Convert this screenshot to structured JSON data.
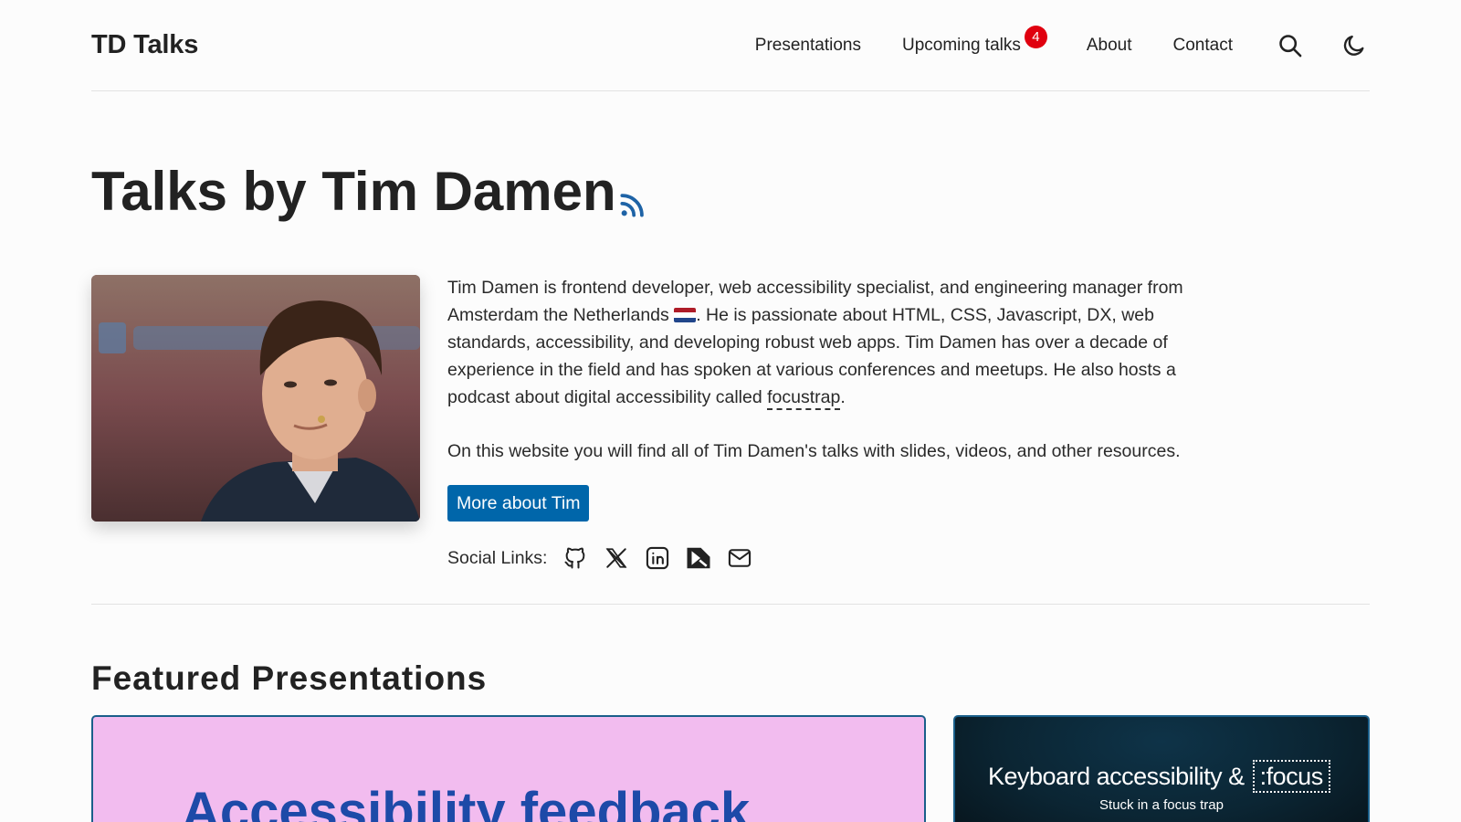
{
  "header": {
    "brand": "TD Talks",
    "nav": [
      {
        "label": "Presentations"
      },
      {
        "label": "Upcoming talks",
        "badge": "4"
      },
      {
        "label": "About"
      },
      {
        "label": "Contact"
      }
    ],
    "icons": [
      "search-icon",
      "moon-icon"
    ]
  },
  "page": {
    "title": "Talks by Tim Damen",
    "title_icon": "rss-icon"
  },
  "hero": {
    "photo_alt": "Photo of Tim Damen",
    "bio_part1": "Tim Damen is frontend developer, web accessibility specialist, and engineering manager from Amsterdam the Netherlands ",
    "bio_part2": ". He is passionate about HTML, CSS, Javascript, DX, web standards, accessibility, and developing robust web apps. Tim Damen has over a decade of experience in the field and has spoken at various conferences and meetups. He also hosts a podcast about digital accessibility called ",
    "bio_link": "focustrap",
    "bio_end": ".",
    "paragraph2": "On this website you will find all of Tim Damen's talks with slides, videos, and other resources.",
    "button": "More about Tim",
    "social_label": "Social Links:",
    "social_icons": [
      "github-icon",
      "x-icon",
      "linkedin-icon",
      "speakerdeck-icon",
      "mail-icon"
    ]
  },
  "featured": {
    "title": "Featured Presentations",
    "cards": [
      {
        "title": "Accessibility feedback"
      },
      {
        "title": "Keyboard accessibility &",
        "title_boxed": ":focus",
        "subtitle": "Stuck in a focus trap"
      }
    ]
  },
  "colors": {
    "accent": "#0066aa",
    "badge": "#e0000f",
    "card1_bg": "#f2bcef",
    "card2_bg": "#0b2533"
  }
}
